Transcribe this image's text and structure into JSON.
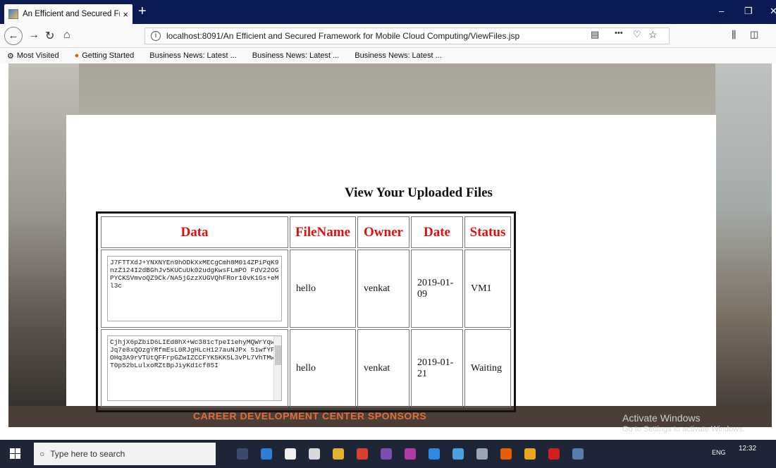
{
  "browser": {
    "tab_title": "An Efficient and Secured Frame",
    "tab_close": "×",
    "new_tab": "+",
    "window_controls": [
      "–",
      "❐",
      "✕"
    ],
    "url_prefix": "localhost",
    "url": "localhost:8091/An Efficient and Secured Framework for Mobile Cloud Computing/ViewFiles.jsp",
    "menu_dots": "•••",
    "bookmarks": [
      {
        "label": "Most Visited",
        "icon": "gear-icon"
      },
      {
        "label": "Getting Started",
        "icon": "firefox-icon"
      },
      {
        "label": "Business News: Latest ...",
        "icon": ""
      },
      {
        "label": "Business News: Latest ...",
        "icon": ""
      },
      {
        "label": "Business News: Latest ...",
        "icon": ""
      }
    ]
  },
  "page": {
    "heading": "View Your Uploaded Files",
    "table": {
      "headers": [
        "Data",
        "FileName",
        "Owner",
        "Date",
        "Status"
      ],
      "rows": [
        {
          "data": "J7FTTXdJ+YNXNYEn9hODkXxMECgCmh8M014ZPiPqK9nzZ124I2dBGhJv5KUCuUk02udgKwsFLmPO FdV22OGPYCKSVmvoQZ9Ck/NA5jGzzXUGVQhFRor10vK1Gs+eMl3c",
          "filename": "hello",
          "owner": "venkat",
          "date": "2019-01-09",
          "status": "VM1"
        },
        {
          "data": "CjhjX6pZbiD6LIEd8hX+Wc381cTpeI1ehyMQWrYqw1Jq7e8xQOzgYRfmEsL0RJgHLcH127auNJPx 51wfYPMOHq3A9rVTUtQFFrpGZwIZCCFYK5KK5L3vPL7VhTMw6T0p52bLulxoRZtBpJiyKd1cf85I",
          "filename": "hello",
          "owner": "venkat",
          "date": "2019-01-21",
          "status": "Waiting"
        }
      ]
    },
    "sponsor_banner": "CAREER DEVELOPMENT CENTER SPONSORS"
  },
  "watermark": {
    "line1": "Activate Windows",
    "line2": "Go to Settings to activate Windows."
  },
  "taskbar": {
    "search_placeholder": "Type here to search",
    "time": "12:32",
    "lang": "ENG"
  },
  "colors": {
    "header_red": "#e01010",
    "titlebar": "#0b1a52",
    "taskbar": "#1d2536"
  }
}
